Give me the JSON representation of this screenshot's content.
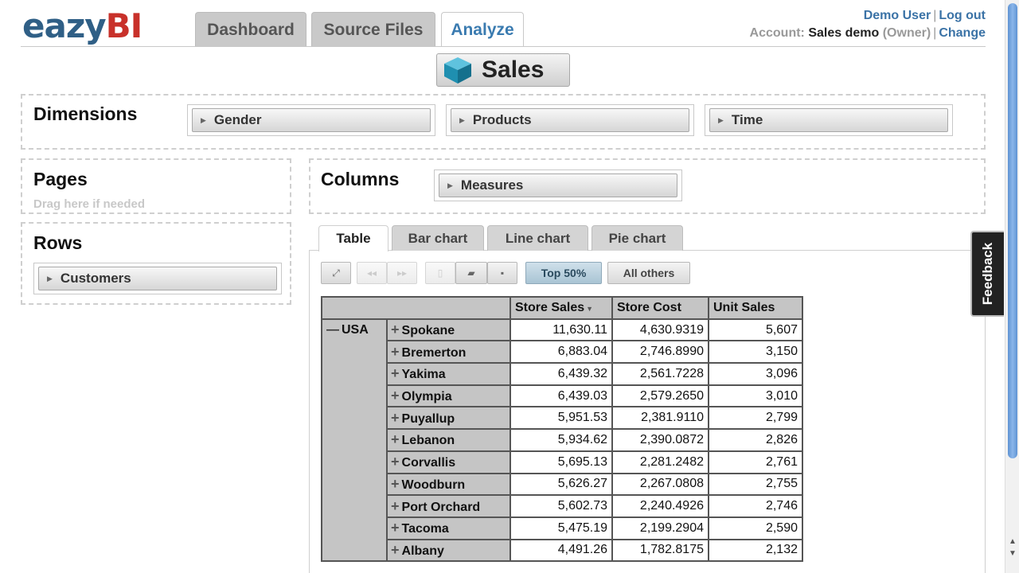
{
  "app": {
    "logo_left": "eazy",
    "logo_right": "BI"
  },
  "nav": {
    "tabs": [
      "Dashboard",
      "Source Files",
      "Analyze"
    ],
    "active": "Analyze"
  },
  "user": {
    "name": "Demo User",
    "logout": "Log out",
    "account_label": "Account:",
    "account_name": "Sales demo",
    "role": "(Owner)",
    "change": "Change"
  },
  "cube": {
    "name": "Sales",
    "icon": "cube-icon",
    "color": "#1f8fb0"
  },
  "dimensions": {
    "title": "Dimensions",
    "items": [
      "Gender",
      "Products",
      "Time"
    ]
  },
  "pages": {
    "title": "Pages",
    "hint": "Drag here if needed"
  },
  "columns": {
    "title": "Columns",
    "items": [
      "Measures"
    ]
  },
  "rows": {
    "title": "Rows",
    "items": [
      "Customers"
    ]
  },
  "view_tabs": {
    "items": [
      "Table",
      "Bar chart",
      "Line chart",
      "Pie chart"
    ],
    "active": "Table"
  },
  "toolbar": {
    "icons": [
      "fullscreen-icon",
      "prev-page-icon",
      "next-page-icon",
      "new-report-icon",
      "open-report-icon",
      "save-report-icon"
    ],
    "top_label": "Top 50%",
    "others_label": "All others"
  },
  "table": {
    "headers": [
      "Store Sales",
      "Store Cost",
      "Unit Sales"
    ],
    "sorted_column": "Store Sales",
    "country": "USA",
    "rows": [
      {
        "city": "Spokane",
        "values": [
          "11,630.11",
          "4,630.9319",
          "5,607"
        ]
      },
      {
        "city": "Bremerton",
        "values": [
          "6,883.04",
          "2,746.8990",
          "3,150"
        ]
      },
      {
        "city": "Yakima",
        "values": [
          "6,439.32",
          "2,561.7228",
          "3,096"
        ]
      },
      {
        "city": "Olympia",
        "values": [
          "6,439.03",
          "2,579.2650",
          "3,010"
        ]
      },
      {
        "city": "Puyallup",
        "values": [
          "5,951.53",
          "2,381.9110",
          "2,799"
        ]
      },
      {
        "city": "Lebanon",
        "values": [
          "5,934.62",
          "2,390.0872",
          "2,826"
        ]
      },
      {
        "city": "Corvallis",
        "values": [
          "5,695.13",
          "2,281.2482",
          "2,761"
        ]
      },
      {
        "city": "Woodburn",
        "values": [
          "5,626.27",
          "2,267.0808",
          "2,755"
        ]
      },
      {
        "city": "Port Orchard",
        "values": [
          "5,602.73",
          "2,240.4926",
          "2,746"
        ]
      },
      {
        "city": "Tacoma",
        "values": [
          "5,475.19",
          "2,199.2904",
          "2,590"
        ]
      },
      {
        "city": "Albany",
        "values": [
          "4,491.26",
          "1,782.8175",
          "2,132"
        ]
      }
    ]
  },
  "feedback": {
    "label": "Feedback"
  },
  "colors": {
    "accent": "#3a72a6",
    "logo_blue": "#2f5f86",
    "logo_red": "#c8312a"
  }
}
